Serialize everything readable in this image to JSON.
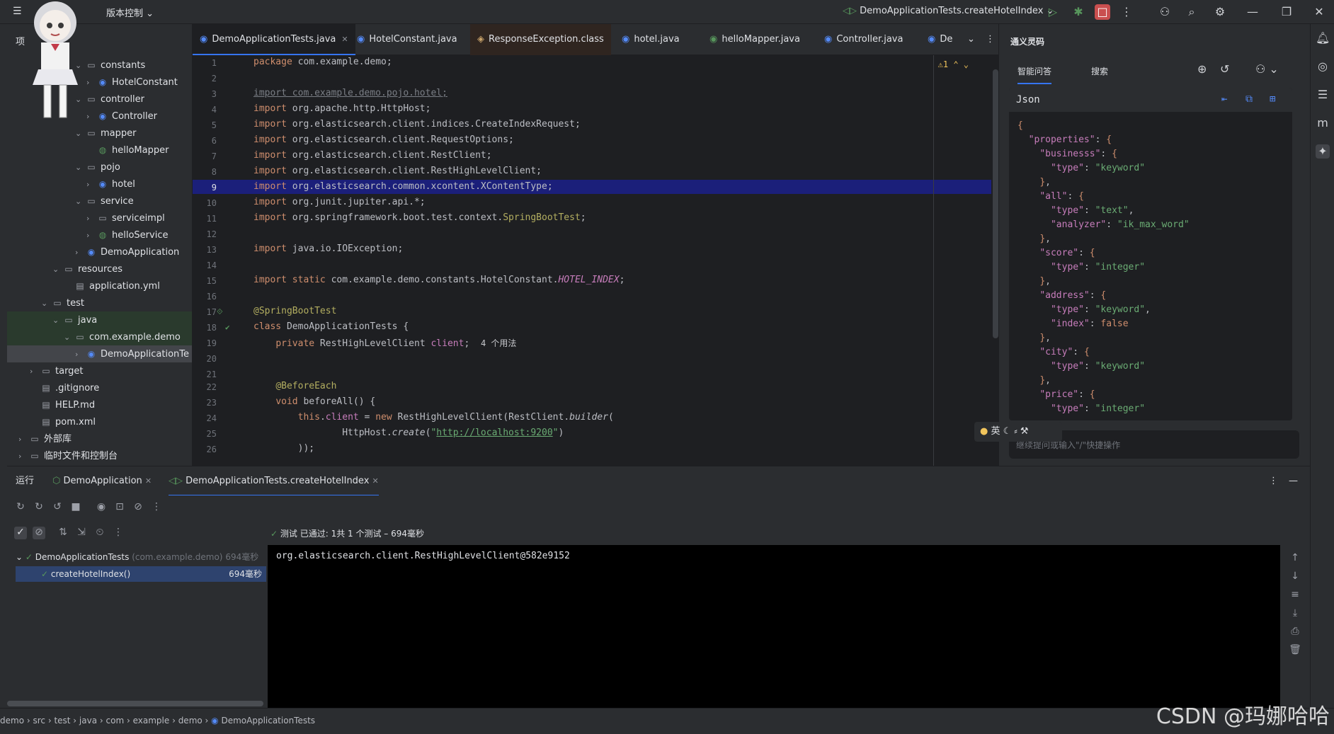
{
  "titlebar": {
    "vcs_label": "版本控制",
    "run_config": "DemoApplicationTests.createHotelIndex"
  },
  "project": {
    "header": "项",
    "tree": [
      {
        "label": "constants",
        "type": "folder",
        "indent": 6,
        "expand": "⌄"
      },
      {
        "label": "HotelConstant",
        "type": "class",
        "indent": 7,
        "expand": "›"
      },
      {
        "label": "controller",
        "type": "folder",
        "indent": 6,
        "expand": "⌄"
      },
      {
        "label": "Controller",
        "type": "class",
        "indent": 7,
        "expand": "›"
      },
      {
        "label": "mapper",
        "type": "folder",
        "indent": 6,
        "expand": "⌄"
      },
      {
        "label": "helloMapper",
        "type": "iface",
        "indent": 7,
        "expand": ""
      },
      {
        "label": "pojo",
        "type": "folder",
        "indent": 6,
        "expand": "⌄"
      },
      {
        "label": "hotel",
        "type": "class",
        "indent": 7,
        "expand": "›"
      },
      {
        "label": "service",
        "type": "folder",
        "indent": 6,
        "expand": "⌄"
      },
      {
        "label": "serviceimpl",
        "type": "folder",
        "indent": 7,
        "expand": "›"
      },
      {
        "label": "helloService",
        "type": "iface",
        "indent": 7,
        "expand": "›"
      },
      {
        "label": "DemoApplication",
        "type": "class",
        "indent": 6,
        "expand": "›"
      },
      {
        "label": "resources",
        "type": "folder",
        "indent": 4,
        "expand": "⌄"
      },
      {
        "label": "application.yml",
        "type": "file",
        "indent": 5,
        "expand": ""
      },
      {
        "label": "test",
        "type": "folder",
        "indent": 3,
        "expand": "⌄"
      },
      {
        "label": "java",
        "type": "folder",
        "indent": 4,
        "expand": "⌄"
      },
      {
        "label": "com.example.demo",
        "type": "folder",
        "indent": 5,
        "expand": "⌄"
      },
      {
        "label": "DemoApplicationTe",
        "type": "class",
        "indent": 6,
        "expand": "›"
      },
      {
        "label": "target",
        "type": "folder",
        "indent": 2,
        "expand": "›"
      },
      {
        "label": ".gitignore",
        "type": "file",
        "indent": 2,
        "expand": ""
      },
      {
        "label": "HELP.md",
        "type": "file",
        "indent": 2,
        "expand": ""
      },
      {
        "label": "pom.xml",
        "type": "file",
        "indent": 2,
        "expand": ""
      },
      {
        "label": "外部库",
        "type": "folder",
        "indent": 1,
        "expand": "›"
      },
      {
        "label": "临时文件和控制台",
        "type": "folder",
        "indent": 1,
        "expand": "›"
      }
    ]
  },
  "tabs": [
    {
      "label": "DemoApplicationTests.java",
      "active": true
    },
    {
      "label": "HotelConstant.java",
      "active": false
    },
    {
      "label": "ResponseException.class",
      "active": false
    },
    {
      "label": "hotel.java",
      "active": false
    },
    {
      "label": "helloMapper.java",
      "active": false
    },
    {
      "label": "Controller.java",
      "active": false
    },
    {
      "label": "De",
      "active": false
    }
  ],
  "editor": {
    "warning_count": "1",
    "line_numbers": [
      "1",
      "2",
      "3",
      "4",
      "5",
      "6",
      "7",
      "8",
      "9",
      "10",
      "11",
      "12",
      "13",
      "14",
      "15",
      "16",
      "17",
      "18",
      "19",
      "20",
      "21",
      "22",
      "23",
      "24",
      "25",
      "26"
    ],
    "usage_hint": "4 个用法",
    "url": "http://localhost:9200"
  },
  "ai_panel": {
    "title": "通义灵码",
    "tab_qa": "智能问答",
    "tab_search": "搜索",
    "json_header": "Json",
    "input_placeholder": "继续提问或输入\"/\"快捷操作",
    "ime": "英"
  },
  "run_panel": {
    "label": "运行",
    "tab1": "DemoApplication",
    "tab2": "DemoApplicationTests.createHotelIndex",
    "test_status": "测试 已通过: 1共 1 个测试 – 694毫秒",
    "tree_root": "DemoApplicationTests",
    "tree_root_pkg": "(com.example.demo)",
    "tree_root_time": "694毫秒",
    "tree_child": "createHotelIndex()",
    "tree_child_time": "694毫秒",
    "console_output": "org.elasticsearch.client.RestHighLevelClient@582e9152"
  },
  "status": {
    "breadcrumbs": [
      "demo",
      "src",
      "test",
      "java",
      "com",
      "example",
      "demo",
      "DemoApplicationTests"
    ],
    "watermark": "CSDN @玛娜哈哈"
  }
}
